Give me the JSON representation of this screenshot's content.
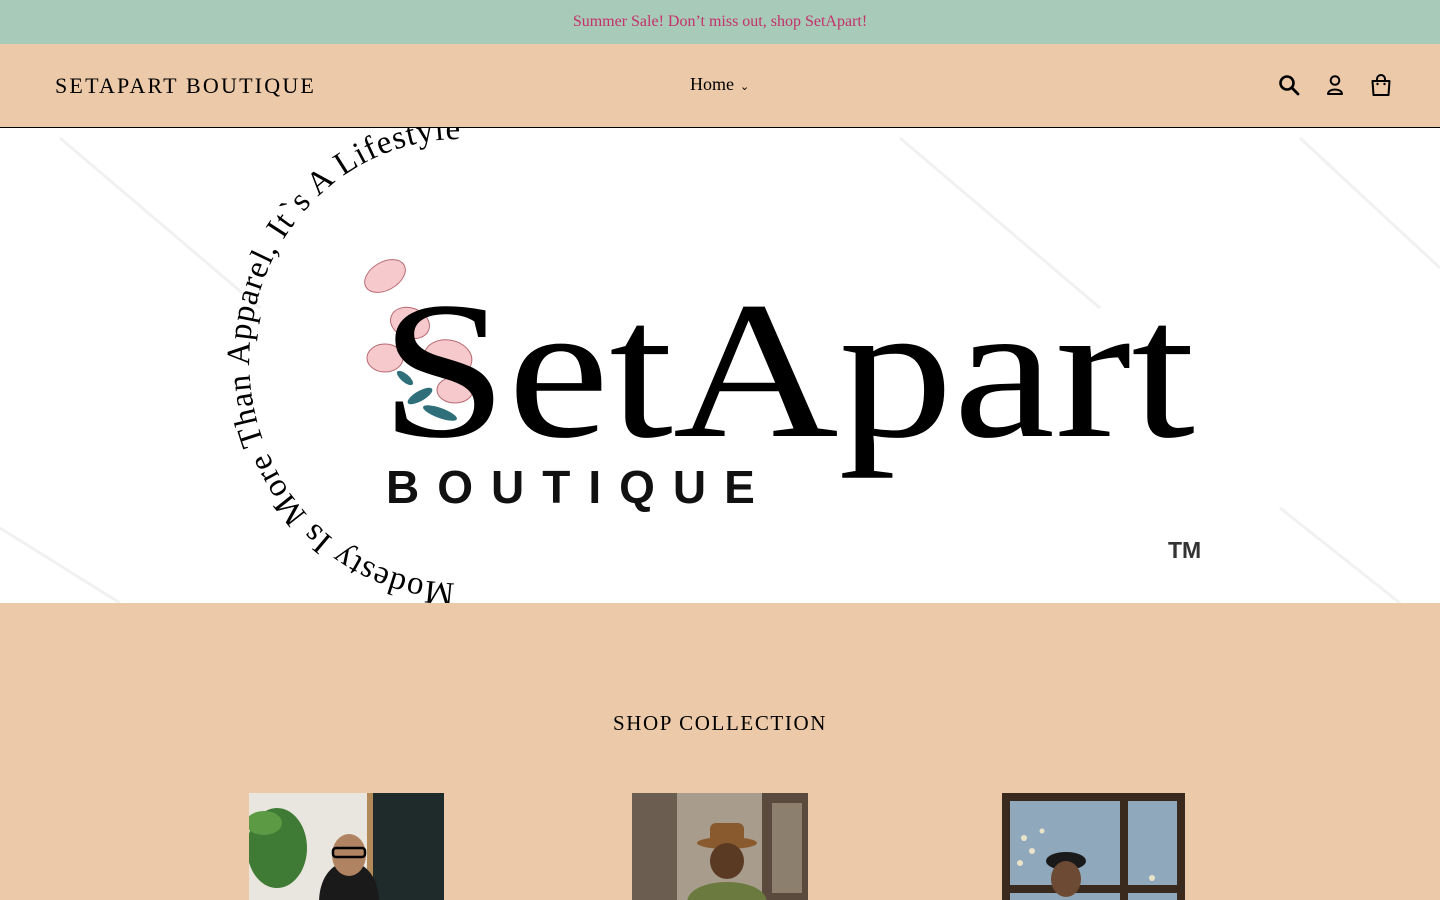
{
  "announcement": {
    "text": "Summer Sale! Don’t miss out, shop SetApart!"
  },
  "header": {
    "brand": "SETAPART BOUTIQUE",
    "nav": {
      "home_label": "Home"
    },
    "icons": [
      "search-icon",
      "account-icon",
      "cart-icon"
    ]
  },
  "hero": {
    "arc_text": "Modesty Is More Than Apparel, It`s A Lifestyle",
    "logo_main": "SetApart",
    "logo_sub": "BOUTIQUE",
    "trademark": "TM"
  },
  "collection": {
    "heading": "SHOP COLLECTION"
  },
  "colors": {
    "announcement_bg": "#a8cbb9",
    "announcement_text": "#c4306a",
    "page_bg": "#ecc9a8"
  }
}
